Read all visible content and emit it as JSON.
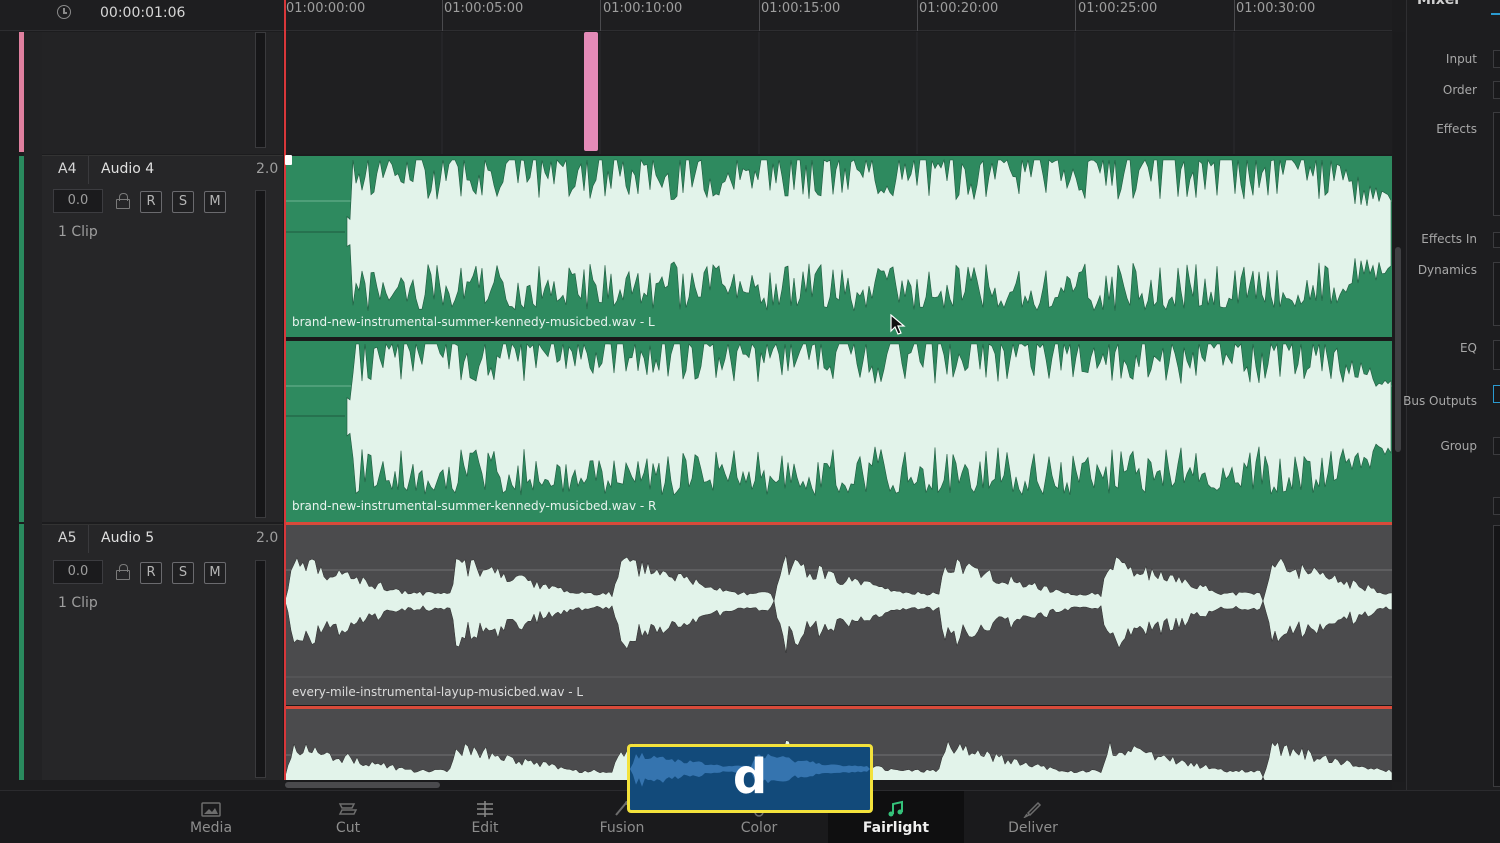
{
  "timeline": {
    "timecode": "00:00:01:06",
    "ruler_ticks": [
      "01:00:00:00",
      "01:00:05:00",
      "01:00:10:00",
      "01:00:15:00",
      "01:00:20:00",
      "01:00:25:00",
      "01:00:30:00"
    ]
  },
  "tracks": [
    {
      "id": "A4",
      "name": "Audio 4",
      "channels": "2.0",
      "volume": "0.0",
      "buttons": [
        "R",
        "S",
        "M"
      ],
      "clip_count": "1 Clip",
      "clips": [
        "brand-new-instrumental-summer-kennedy-musicbed.wav - L",
        "brand-new-instrumental-summer-kennedy-musicbed.wav - R"
      ]
    },
    {
      "id": "A5",
      "name": "Audio 5",
      "channels": "2.0",
      "volume": "0.0",
      "buttons": [
        "R",
        "S",
        "M"
      ],
      "clip_count": "1 Clip",
      "clips": [
        "every-mile-instrumental-layup-musicbed.wav - L"
      ]
    }
  ],
  "mixer": {
    "title": "Mixer",
    "labels": [
      "Input",
      "Order",
      "Effects",
      "Effects In",
      "Dynamics",
      "EQ",
      "Bus Outputs",
      "Group"
    ]
  },
  "pages": [
    {
      "label": "Media",
      "icon": "media-icon"
    },
    {
      "label": "Cut",
      "icon": "cut-icon"
    },
    {
      "label": "Edit",
      "icon": "edit-icon"
    },
    {
      "label": "Fusion",
      "icon": "fusion-icon"
    },
    {
      "label": "Color",
      "icon": "color-icon"
    },
    {
      "label": "Fairlight",
      "icon": "fairlight-icon",
      "active": true
    },
    {
      "label": "Deliver",
      "icon": "deliver-icon"
    }
  ],
  "key_overlay": {
    "key": "d"
  },
  "colors": {
    "track_a4_clip": "#2e8a5f",
    "track_a5_clip": "#4b4b4d",
    "waveform": "#e2f3ea",
    "playhead": "#d8373a",
    "marker": "#e48bb8",
    "key_border": "#f3e23c"
  }
}
